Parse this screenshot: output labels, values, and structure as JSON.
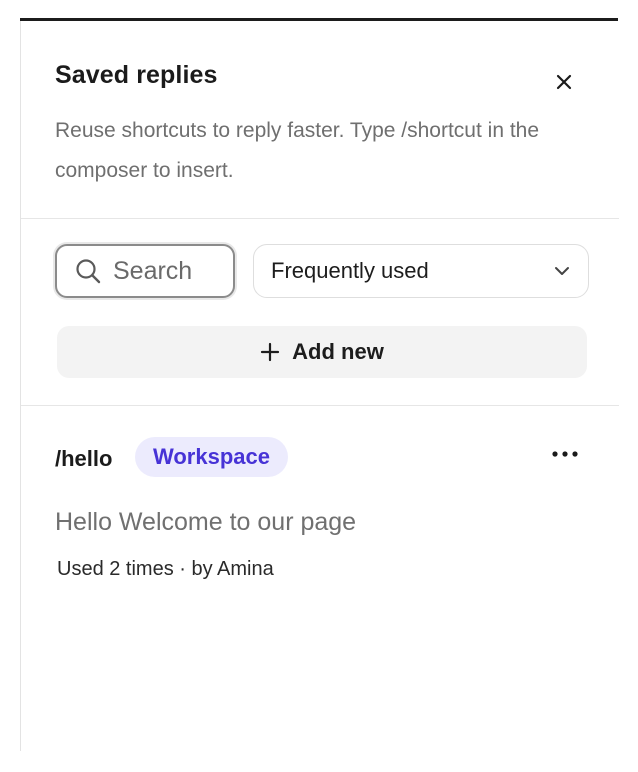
{
  "panel": {
    "title": "Saved replies",
    "description": "Reuse shortcuts to reply faster. Type /shortcut in the composer to insert."
  },
  "controls": {
    "search_placeholder": "Search",
    "sort_selected": "Frequently used",
    "add_label": "Add new"
  },
  "replies": [
    {
      "shortcut": "/hello",
      "scope": "Workspace",
      "text": "Hello Welcome to our page",
      "meta": "Used 2 times · by Amina"
    }
  ],
  "colors": {
    "badge_bg": "#ecebfd",
    "badge_text": "#4733d6",
    "add_button_bg": "#f3f3f3"
  },
  "icons": [
    "close-icon",
    "search-icon",
    "chevron-down-icon",
    "plus-icon",
    "more-horizontal-icon"
  ]
}
